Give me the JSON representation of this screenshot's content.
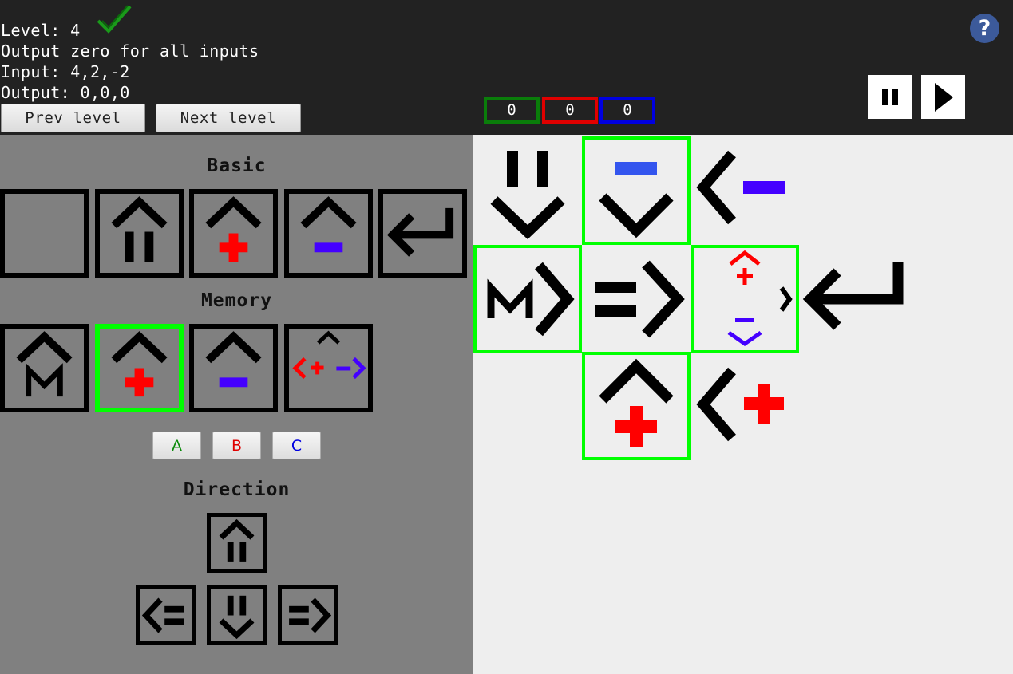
{
  "level": {
    "label": "Level: 4",
    "description": "Output zero for all inputs",
    "input": "Input: 4,2,-2",
    "output": "Output: 0,0,0",
    "solved": true
  },
  "nav": {
    "prev_label": "Prev level",
    "next_label": "Next level"
  },
  "registers": [
    {
      "value": "0",
      "color": "#0a7d0a"
    },
    {
      "value": "0",
      "color": "#e00000"
    },
    {
      "value": "0",
      "color": "#0000e0"
    }
  ],
  "controls": {
    "help_label": "?"
  },
  "palette": {
    "basic_title": "Basic",
    "basic_tiles": [
      "empty",
      "up-wait",
      "up-add",
      "up-subtract",
      "return"
    ],
    "memory_title": "Memory",
    "memory_tiles": [
      "up-memory",
      "up-add",
      "up-subtract",
      "branch"
    ],
    "memory_selected": "up-add",
    "register_buttons": [
      {
        "label": "A",
        "color": "#0a8a0a"
      },
      {
        "label": "B",
        "color": "#e00000"
      },
      {
        "label": "C",
        "color": "#0000e0"
      }
    ],
    "direction_title": "Direction",
    "direction_tiles": [
      "up",
      "left",
      "down",
      "right"
    ]
  },
  "board": {
    "cells": [
      {
        "name": "down-wait",
        "highlighted": false
      },
      {
        "name": "down-subtract",
        "highlighted": true
      },
      {
        "name": "left-subtract",
        "highlighted": false
      },
      {
        "name": "right-memory",
        "highlighted": true
      },
      {
        "name": "right",
        "highlighted": false
      },
      {
        "name": "branch",
        "highlighted": true
      },
      {
        "name": "return",
        "highlighted": false
      },
      {
        "name": "up-add",
        "highlighted": true
      },
      {
        "name": "left-add",
        "highlighted": false
      }
    ]
  },
  "colors": {
    "add": "#ff0000",
    "subtract": "#4400ff",
    "subtract_board": "#3355ee",
    "highlight": "#00ff00"
  }
}
